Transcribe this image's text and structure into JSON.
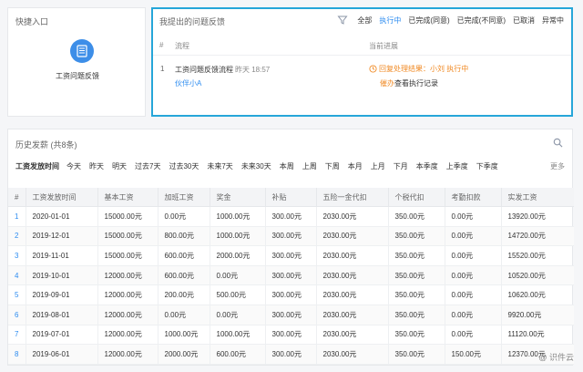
{
  "quick_entry": {
    "title": "快捷入口",
    "app_label": "工资问题反馈",
    "app_color": "#3d8ee8"
  },
  "feedback": {
    "title": "我提出的问题反馈",
    "filters": [
      "全部",
      "执行中",
      "已完成(同意)",
      "已完成(不同意)",
      "已取消",
      "异常中"
    ],
    "active_filter": "执行中",
    "headers": {
      "num": "#",
      "flow": "流程",
      "progress": "当前进展"
    },
    "rows": [
      {
        "num": "1",
        "flow_name": "工资问题反馈流程",
        "time": "昨天 18:57",
        "submitter": "伙伴小A",
        "progress_status": "回复处理结果：小刘 执行中",
        "urge": "催办",
        "view_log": "查看执行记录"
      }
    ],
    "border_color": "#26a6d9"
  },
  "history": {
    "title": "历史发薪 (共8条)",
    "date_label": "工资发放时间",
    "date_options": [
      "今天",
      "昨天",
      "明天",
      "过去7天",
      "过去30天",
      "未来7天",
      "未来30天",
      "本周",
      "上周",
      "下周",
      "本月",
      "上月",
      "下月",
      "本季度",
      "上季度",
      "下季度"
    ],
    "more": "更多",
    "columns": [
      "#",
      "工资发放时间",
      "基本工资",
      "加班工资",
      "奖金",
      "补贴",
      "五险一金代扣",
      "个税代扣",
      "考勤扣款",
      "实发工资"
    ],
    "rows": [
      [
        "1",
        "2020-01-01",
        "15000.00元",
        "0.00元",
        "1000.00元",
        "300.00元",
        "2030.00元",
        "350.00元",
        "0.00元",
        "13920.00元"
      ],
      [
        "2",
        "2019-12-01",
        "15000.00元",
        "800.00元",
        "1000.00元",
        "300.00元",
        "2030.00元",
        "350.00元",
        "0.00元",
        "14720.00元"
      ],
      [
        "3",
        "2019-11-01",
        "15000.00元",
        "600.00元",
        "2000.00元",
        "300.00元",
        "2030.00元",
        "350.00元",
        "0.00元",
        "15520.00元"
      ],
      [
        "4",
        "2019-10-01",
        "12000.00元",
        "600.00元",
        "0.00元",
        "300.00元",
        "2030.00元",
        "350.00元",
        "0.00元",
        "10520.00元"
      ],
      [
        "5",
        "2019-09-01",
        "12000.00元",
        "200.00元",
        "500.00元",
        "300.00元",
        "2030.00元",
        "350.00元",
        "0.00元",
        "10620.00元"
      ],
      [
        "6",
        "2019-08-01",
        "12000.00元",
        "0.00元",
        "0.00元",
        "300.00元",
        "2030.00元",
        "350.00元",
        "0.00元",
        "9920.00元"
      ],
      [
        "7",
        "2019-07-01",
        "12000.00元",
        "1000.00元",
        "1000.00元",
        "300.00元",
        "2030.00元",
        "350.00元",
        "0.00元",
        "11120.00元"
      ],
      [
        "8",
        "2019-06-01",
        "12000.00元",
        "2000.00元",
        "600.00元",
        "300.00元",
        "2030.00元",
        "350.00元",
        "150.00元",
        "12370.00元"
      ]
    ]
  },
  "watermark": "@ 识件云"
}
